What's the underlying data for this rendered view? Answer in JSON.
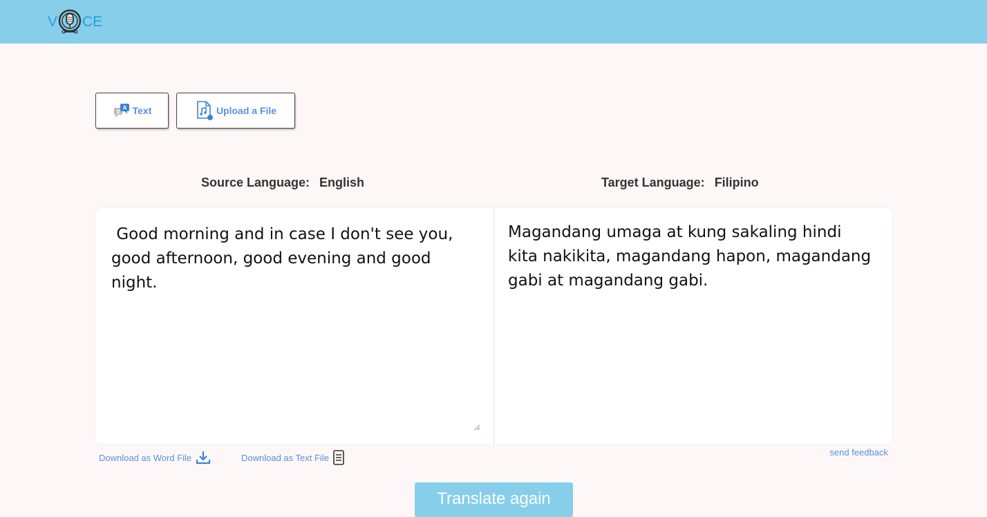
{
  "header": {
    "logo_left": "V",
    "logo_right": "CE",
    "bg_color": "#87ceea"
  },
  "modes": {
    "text_label": "Text",
    "text_icon": "text-translate-icon",
    "upload_label": "Upload a File",
    "upload_icon": "audio-file-icon"
  },
  "languages": {
    "source_label": "Source Language:",
    "source_value": "English",
    "target_label": "Target Language:",
    "target_value": "Filipino"
  },
  "source_text": " Good morning and in case I don't see you, good afternoon, good evening and good night.",
  "target_text": "Magandang umaga at kung sakaling hindi kita nakikita, magandang hapon, magandang gabi at magandang gabi.",
  "downloads": {
    "word_label": "Download as Word File",
    "word_icon": "download-icon",
    "text_label": "Download as Text File",
    "text_icon": "document-icon"
  },
  "feedback_label": "send feedback",
  "translate_label": "Translate again",
  "colors": {
    "accent": "#5b8fe0",
    "button_bg": "#87ceea",
    "page_bg": "#fdf8f7"
  }
}
